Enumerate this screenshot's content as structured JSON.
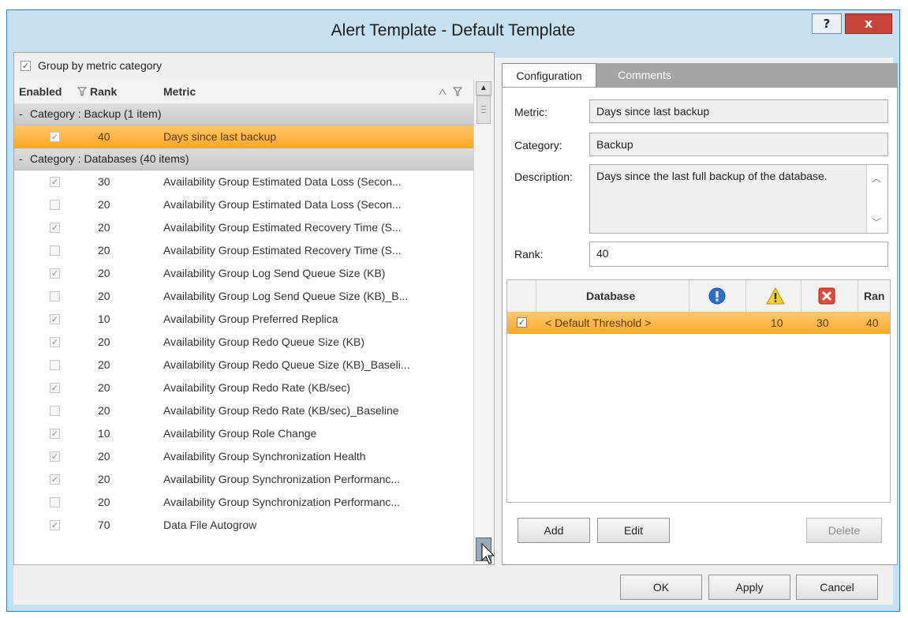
{
  "window": {
    "title": "Alert Template - Default Template",
    "help_label": "?",
    "close_label": "x"
  },
  "left": {
    "group_by_label": "Group by metric category",
    "group_by_checked": true,
    "columns": {
      "enabled": "Enabled",
      "rank": "Rank",
      "metric": "Metric"
    },
    "categories": [
      {
        "label": "Category : Backup (1 item)",
        "expand": "-"
      },
      {
        "label": "Category : Databases (40 items)",
        "expand": "-"
      }
    ],
    "backup_rows": [
      {
        "checked": true,
        "rank": "40",
        "metric": "Days since last backup",
        "selected": true
      }
    ],
    "database_rows": [
      {
        "checked": true,
        "rank": "30",
        "metric": "Availability Group Estimated Data Loss (Secon..."
      },
      {
        "checked": false,
        "rank": "20",
        "metric": "Availability Group Estimated Data Loss (Secon..."
      },
      {
        "checked": true,
        "rank": "20",
        "metric": "Availability Group Estimated Recovery Time (S..."
      },
      {
        "checked": false,
        "rank": "20",
        "metric": "Availability Group Estimated Recovery Time (S..."
      },
      {
        "checked": true,
        "rank": "20",
        "metric": "Availability Group Log Send Queue Size (KB)"
      },
      {
        "checked": false,
        "rank": "20",
        "metric": "Availability Group Log Send Queue Size (KB)_B..."
      },
      {
        "checked": true,
        "rank": "10",
        "metric": "Availability Group Preferred Replica"
      },
      {
        "checked": true,
        "rank": "20",
        "metric": "Availability Group Redo Queue Size (KB)"
      },
      {
        "checked": false,
        "rank": "20",
        "metric": "Availability Group Redo Queue Size (KB)_Baseli..."
      },
      {
        "checked": true,
        "rank": "20",
        "metric": "Availability Group Redo Rate (KB/sec)"
      },
      {
        "checked": false,
        "rank": "20",
        "metric": "Availability Group Redo Rate (KB/sec)_Baseline"
      },
      {
        "checked": true,
        "rank": "10",
        "metric": "Availability Group Role Change"
      },
      {
        "checked": true,
        "rank": "20",
        "metric": "Availability Group Synchronization Health"
      },
      {
        "checked": true,
        "rank": "20",
        "metric": "Availability Group Synchronization Performanc..."
      },
      {
        "checked": false,
        "rank": "20",
        "metric": "Availability Group Synchronization Performanc..."
      },
      {
        "checked": true,
        "rank": "70",
        "metric": "Data File Autogrow"
      }
    ]
  },
  "tabs": {
    "configuration": "Configuration",
    "comments": "Comments"
  },
  "config": {
    "metric_label": "Metric:",
    "metric_value": "Days since last backup",
    "category_label": "Category:",
    "category_value": "Backup",
    "description_label": "Description:",
    "description_value": "Days since the last full backup of the database.",
    "rank_label": "Rank:",
    "rank_value": "40"
  },
  "thresholds": {
    "columns": {
      "database": "Database",
      "rank": "Ran"
    },
    "row": {
      "checked": true,
      "database": "< Default Threshold >",
      "warning": "10",
      "critical": "30",
      "rank": "40"
    }
  },
  "buttons": {
    "add": "Add",
    "edit": "Edit",
    "delete": "Delete",
    "ok": "OK",
    "apply": "Apply",
    "cancel": "Cancel"
  },
  "colors": {
    "selection": "#ffaa2b",
    "frame": "#c6e2f2",
    "close": "#c8443a"
  }
}
